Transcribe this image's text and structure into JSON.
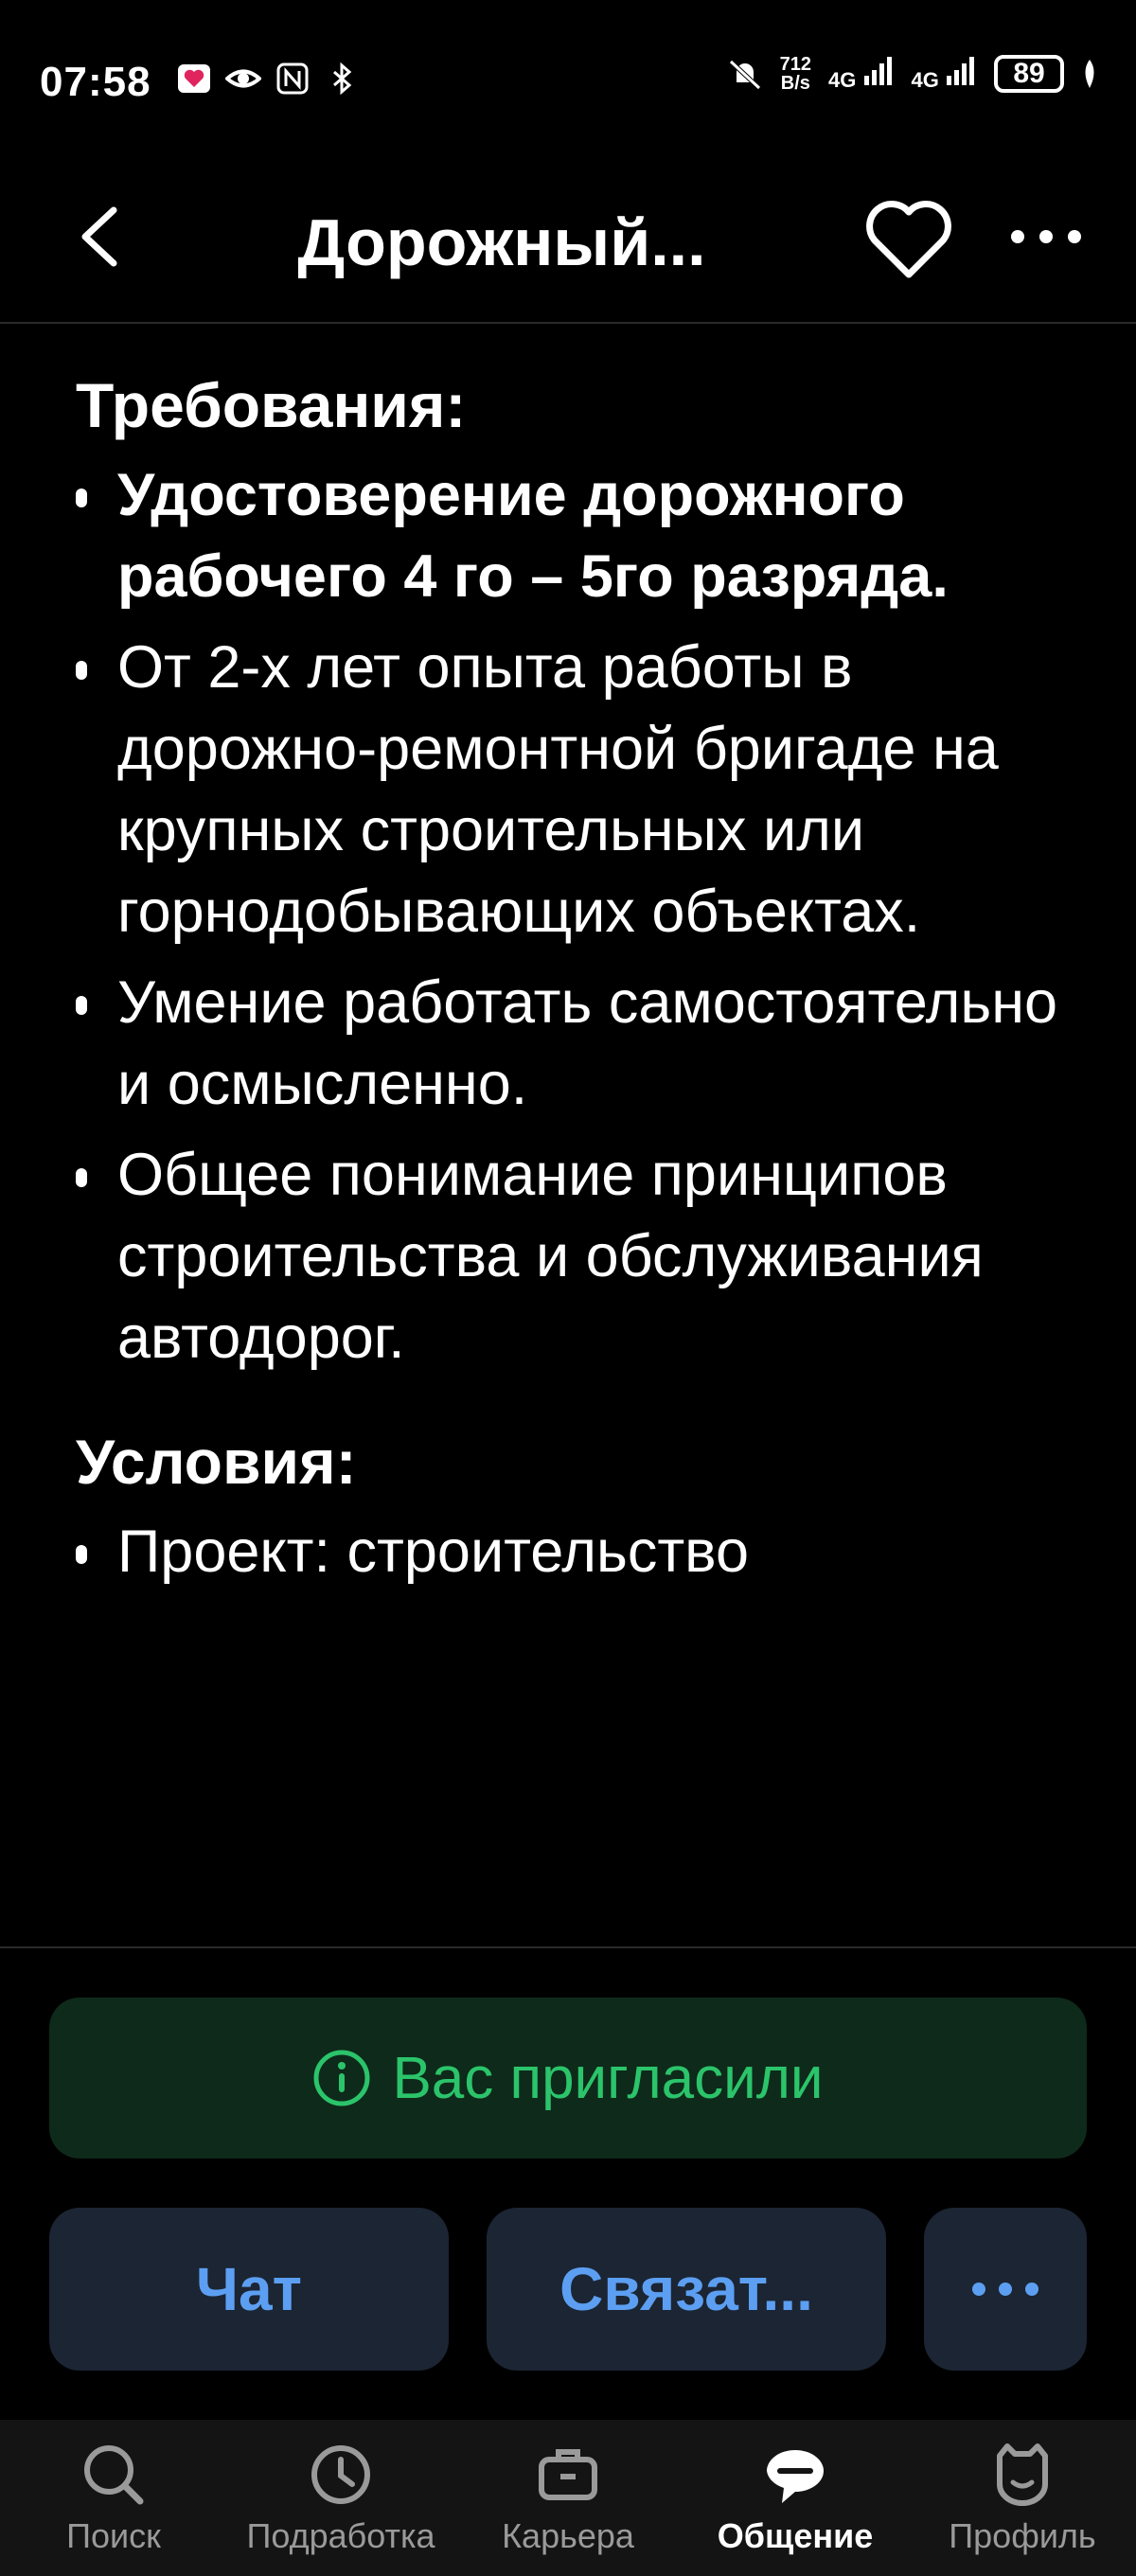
{
  "status_bar": {
    "time": "07:58",
    "speed_top": "712",
    "speed_bottom": "B/s",
    "net1": "4G",
    "net2": "4G",
    "battery": "89"
  },
  "header": {
    "title": "Дорожный..."
  },
  "content": {
    "requirements_title": "Требования:",
    "requirements": [
      "Удостоверение дорожного рабочего 4 го – 5го разряда.",
      "От 2-х лет опыта работы в дорожно-ремонтной бригаде на крупных строительных или горнодобывающих объектах.",
      "Умение работать самостоятельно и осмысленно.",
      "Общее понимание принципов строительства и обслуживания автодорог."
    ],
    "conditions_title": "Условия:",
    "conditions": [
      "Проект: строительство"
    ]
  },
  "invite": {
    "label": "Вас пригласили",
    "color": "#2bc46b"
  },
  "actions": {
    "chat": "Чат",
    "contact": "Связат...",
    "more": "•••"
  },
  "bottom_nav": [
    {
      "label": "Поиск",
      "icon": "search-icon"
    },
    {
      "label": "Подработка",
      "icon": "clock-icon"
    },
    {
      "label": "Карьера",
      "icon": "briefcase-icon"
    },
    {
      "label": "Общение",
      "icon": "chat-bubble-icon",
      "active": true
    },
    {
      "label": "Профиль",
      "icon": "profile-icon"
    }
  ]
}
